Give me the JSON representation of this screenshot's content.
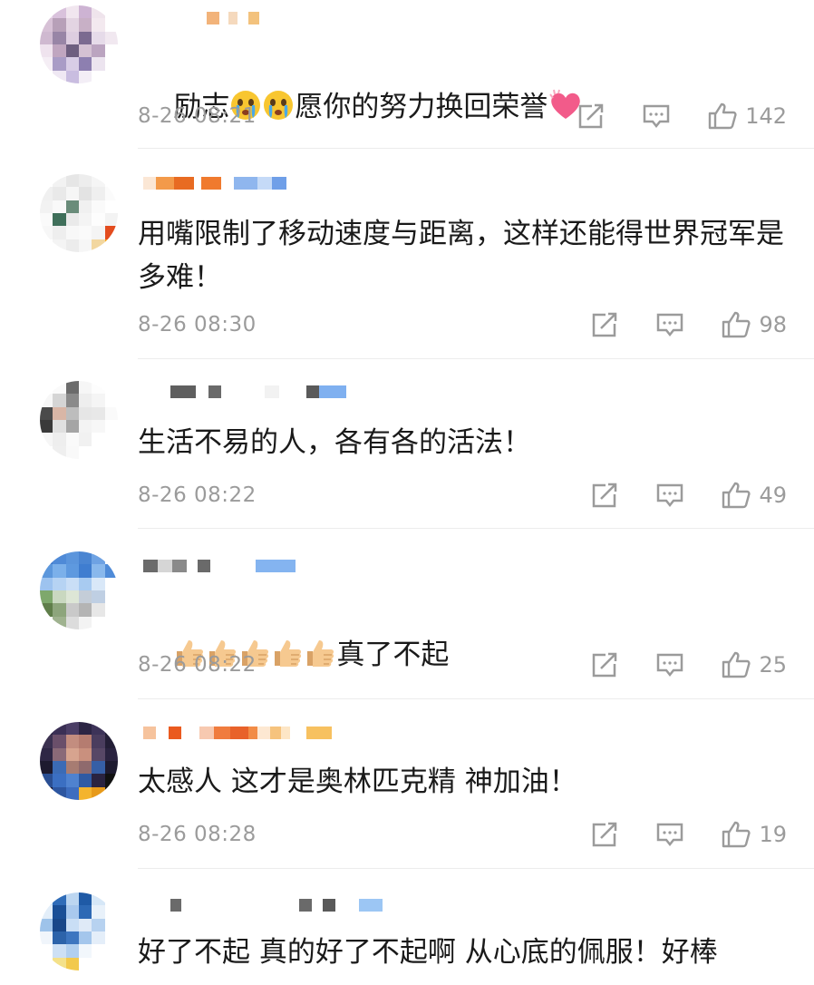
{
  "comments": [
    {
      "text_pre": "励志",
      "text_post": "愿你的努力换回荣誉",
      "time": "8-26 08:21",
      "likes": "142",
      "emoji_before": [
        "crying-face-emoji",
        "crying-face-emoji"
      ],
      "emoji_after": [
        "heart-emoji"
      ]
    },
    {
      "text": "用嘴限制了移动速度与距离，这样还能得世界冠军是多难！",
      "time": "8-26 08:30",
      "likes": "98"
    },
    {
      "text": "生活不易的人，各有各的活法！",
      "time": "8-26 08:22",
      "likes": "49"
    },
    {
      "text_post": "真了不起",
      "time": "8-26 08:22",
      "likes": "25",
      "emoji_before": [
        "thumbs-up-emoji",
        "thumbs-up-emoji",
        "thumbs-up-emoji",
        "thumbs-up-emoji",
        "thumbs-up-emoji"
      ]
    },
    {
      "text": "太感人 这才是奥林匹克精 神加油！",
      "time": "8-26 08:28",
      "likes": "19"
    },
    {
      "text": "好了不起 真的好了不起啊 从心底的佩服！好棒"
    }
  ],
  "icons": {
    "share": "share-icon",
    "comment": "comment-icon",
    "like": "thumbs-up-icon"
  },
  "colors": {
    "text": "#1a1a1a",
    "meta": "#9b9b9b",
    "divider": "#ececec"
  }
}
